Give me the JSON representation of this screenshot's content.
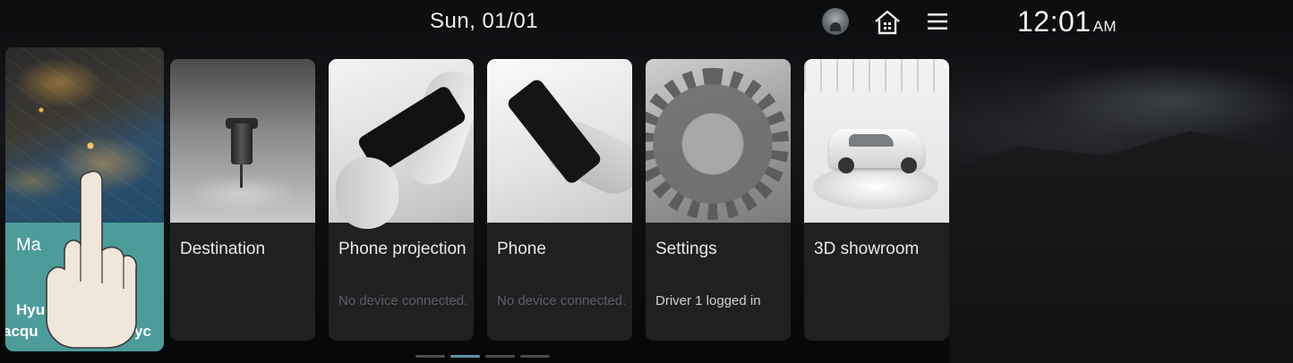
{
  "status_bar": {
    "date": "Sun, 01/01",
    "time": "12:01",
    "ampm": "AM",
    "icons": [
      "profile-icon",
      "home-icon",
      "menu-icon"
    ]
  },
  "cards": {
    "map": {
      "title": "Ma",
      "subtitle_line1": "Hyu",
      "subtitle_line2": "acqu",
      "subtitle_line2_right": "Syc"
    },
    "destination": {
      "title": "Destination"
    },
    "phone_projection": {
      "title": "Phone projection",
      "status": "No device connected."
    },
    "phone": {
      "title": "Phone",
      "status": "No device connected."
    },
    "settings": {
      "title": "Settings",
      "status": "Driver 1 logged in"
    },
    "showroom": {
      "title": "3D showroom"
    }
  },
  "pagination": {
    "pages": 4,
    "current": 2
  },
  "colors": {
    "accent": "#5b93a6",
    "map_card": "#4c9c9a",
    "card_bg": "#1f2022"
  }
}
